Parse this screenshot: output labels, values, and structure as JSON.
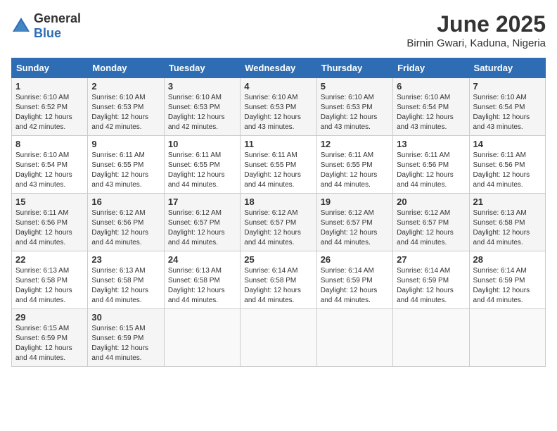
{
  "logo": {
    "general": "General",
    "blue": "Blue"
  },
  "title": "June 2025",
  "subtitle": "Birnin Gwari, Kaduna, Nigeria",
  "weekdays": [
    "Sunday",
    "Monday",
    "Tuesday",
    "Wednesday",
    "Thursday",
    "Friday",
    "Saturday"
  ],
  "weeks": [
    [
      {
        "day": "1",
        "sunrise": "6:10 AM",
        "sunset": "6:52 PM",
        "daylight": "12 hours and 42 minutes."
      },
      {
        "day": "2",
        "sunrise": "6:10 AM",
        "sunset": "6:53 PM",
        "daylight": "12 hours and 42 minutes."
      },
      {
        "day": "3",
        "sunrise": "6:10 AM",
        "sunset": "6:53 PM",
        "daylight": "12 hours and 42 minutes."
      },
      {
        "day": "4",
        "sunrise": "6:10 AM",
        "sunset": "6:53 PM",
        "daylight": "12 hours and 43 minutes."
      },
      {
        "day": "5",
        "sunrise": "6:10 AM",
        "sunset": "6:53 PM",
        "daylight": "12 hours and 43 minutes."
      },
      {
        "day": "6",
        "sunrise": "6:10 AM",
        "sunset": "6:54 PM",
        "daylight": "12 hours and 43 minutes."
      },
      {
        "day": "7",
        "sunrise": "6:10 AM",
        "sunset": "6:54 PM",
        "daylight": "12 hours and 43 minutes."
      }
    ],
    [
      {
        "day": "8",
        "sunrise": "6:10 AM",
        "sunset": "6:54 PM",
        "daylight": "12 hours and 43 minutes."
      },
      {
        "day": "9",
        "sunrise": "6:11 AM",
        "sunset": "6:55 PM",
        "daylight": "12 hours and 43 minutes."
      },
      {
        "day": "10",
        "sunrise": "6:11 AM",
        "sunset": "6:55 PM",
        "daylight": "12 hours and 44 minutes."
      },
      {
        "day": "11",
        "sunrise": "6:11 AM",
        "sunset": "6:55 PM",
        "daylight": "12 hours and 44 minutes."
      },
      {
        "day": "12",
        "sunrise": "6:11 AM",
        "sunset": "6:55 PM",
        "daylight": "12 hours and 44 minutes."
      },
      {
        "day": "13",
        "sunrise": "6:11 AM",
        "sunset": "6:56 PM",
        "daylight": "12 hours and 44 minutes."
      },
      {
        "day": "14",
        "sunrise": "6:11 AM",
        "sunset": "6:56 PM",
        "daylight": "12 hours and 44 minutes."
      }
    ],
    [
      {
        "day": "15",
        "sunrise": "6:11 AM",
        "sunset": "6:56 PM",
        "daylight": "12 hours and 44 minutes."
      },
      {
        "day": "16",
        "sunrise": "6:12 AM",
        "sunset": "6:56 PM",
        "daylight": "12 hours and 44 minutes."
      },
      {
        "day": "17",
        "sunrise": "6:12 AM",
        "sunset": "6:57 PM",
        "daylight": "12 hours and 44 minutes."
      },
      {
        "day": "18",
        "sunrise": "6:12 AM",
        "sunset": "6:57 PM",
        "daylight": "12 hours and 44 minutes."
      },
      {
        "day": "19",
        "sunrise": "6:12 AM",
        "sunset": "6:57 PM",
        "daylight": "12 hours and 44 minutes."
      },
      {
        "day": "20",
        "sunrise": "6:12 AM",
        "sunset": "6:57 PM",
        "daylight": "12 hours and 44 minutes."
      },
      {
        "day": "21",
        "sunrise": "6:13 AM",
        "sunset": "6:58 PM",
        "daylight": "12 hours and 44 minutes."
      }
    ],
    [
      {
        "day": "22",
        "sunrise": "6:13 AM",
        "sunset": "6:58 PM",
        "daylight": "12 hours and 44 minutes."
      },
      {
        "day": "23",
        "sunrise": "6:13 AM",
        "sunset": "6:58 PM",
        "daylight": "12 hours and 44 minutes."
      },
      {
        "day": "24",
        "sunrise": "6:13 AM",
        "sunset": "6:58 PM",
        "daylight": "12 hours and 44 minutes."
      },
      {
        "day": "25",
        "sunrise": "6:14 AM",
        "sunset": "6:58 PM",
        "daylight": "12 hours and 44 minutes."
      },
      {
        "day": "26",
        "sunrise": "6:14 AM",
        "sunset": "6:59 PM",
        "daylight": "12 hours and 44 minutes."
      },
      {
        "day": "27",
        "sunrise": "6:14 AM",
        "sunset": "6:59 PM",
        "daylight": "12 hours and 44 minutes."
      },
      {
        "day": "28",
        "sunrise": "6:14 AM",
        "sunset": "6:59 PM",
        "daylight": "12 hours and 44 minutes."
      }
    ],
    [
      {
        "day": "29",
        "sunrise": "6:15 AM",
        "sunset": "6:59 PM",
        "daylight": "12 hours and 44 minutes."
      },
      {
        "day": "30",
        "sunrise": "6:15 AM",
        "sunset": "6:59 PM",
        "daylight": "12 hours and 44 minutes."
      },
      {
        "day": "",
        "sunrise": "",
        "sunset": "",
        "daylight": ""
      },
      {
        "day": "",
        "sunrise": "",
        "sunset": "",
        "daylight": ""
      },
      {
        "day": "",
        "sunrise": "",
        "sunset": "",
        "daylight": ""
      },
      {
        "day": "",
        "sunrise": "",
        "sunset": "",
        "daylight": ""
      },
      {
        "day": "",
        "sunrise": "",
        "sunset": "",
        "daylight": ""
      }
    ]
  ]
}
